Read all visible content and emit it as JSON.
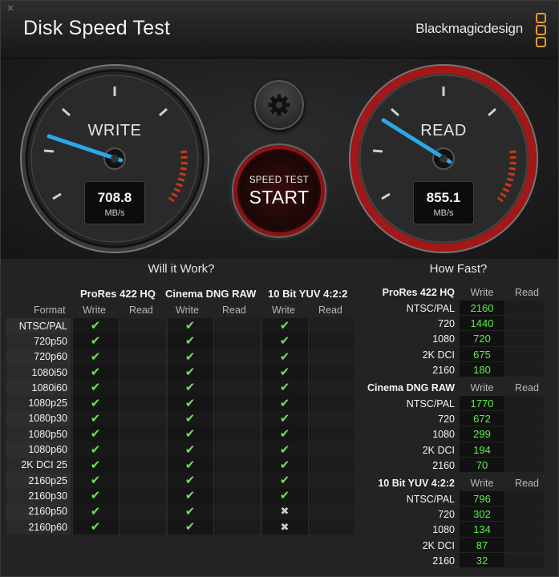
{
  "window": {
    "title": "Disk Speed Test",
    "brand": "Blackmagicdesign",
    "close_glyph": "✕"
  },
  "gauges": {
    "write": {
      "label": "WRITE",
      "value": "708.8",
      "unit": "MB/s"
    },
    "read": {
      "label": "READ",
      "value": "855.1",
      "unit": "MB/s"
    }
  },
  "controls": {
    "settings_icon": "gear-icon",
    "start_small": "SPEED TEST",
    "start_big": "START"
  },
  "will_it_work": {
    "heading": "Will it Work?",
    "format_label": "Format",
    "groups": [
      {
        "name": "ProRes 422 HQ",
        "write": "Write",
        "read": "Read"
      },
      {
        "name": "Cinema DNG RAW",
        "write": "Write",
        "read": "Read"
      },
      {
        "name": "10 Bit YUV 4:2:2",
        "write": "Write",
        "read": "Read"
      }
    ],
    "rows": [
      {
        "format": "NTSC/PAL",
        "w": [
          true,
          true,
          true
        ]
      },
      {
        "format": "720p50",
        "w": [
          true,
          true,
          true
        ]
      },
      {
        "format": "720p60",
        "w": [
          true,
          true,
          true
        ]
      },
      {
        "format": "1080i50",
        "w": [
          true,
          true,
          true
        ]
      },
      {
        "format": "1080i60",
        "w": [
          true,
          true,
          true
        ]
      },
      {
        "format": "1080p25",
        "w": [
          true,
          true,
          true
        ]
      },
      {
        "format": "1080p30",
        "w": [
          true,
          true,
          true
        ]
      },
      {
        "format": "1080p50",
        "w": [
          true,
          true,
          true
        ]
      },
      {
        "format": "1080p60",
        "w": [
          true,
          true,
          true
        ]
      },
      {
        "format": "2K DCI 25",
        "w": [
          true,
          true,
          true
        ]
      },
      {
        "format": "2160p25",
        "w": [
          true,
          true,
          true
        ]
      },
      {
        "format": "2160p30",
        "w": [
          true,
          true,
          true
        ]
      },
      {
        "format": "2160p50",
        "w": [
          true,
          true,
          false
        ]
      },
      {
        "format": "2160p60",
        "w": [
          true,
          true,
          false
        ]
      }
    ]
  },
  "how_fast": {
    "heading": "How Fast?",
    "groups": [
      {
        "name": "ProRes 422 HQ",
        "write": "Write",
        "read": "Read",
        "rows": [
          {
            "res": "NTSC/PAL",
            "w": "2160"
          },
          {
            "res": "720",
            "w": "1440"
          },
          {
            "res": "1080",
            "w": "720"
          },
          {
            "res": "2K DCI",
            "w": "675"
          },
          {
            "res": "2160",
            "w": "180"
          }
        ]
      },
      {
        "name": "Cinema DNG RAW",
        "write": "Write",
        "read": "Read",
        "rows": [
          {
            "res": "NTSC/PAL",
            "w": "1770"
          },
          {
            "res": "720",
            "w": "672"
          },
          {
            "res": "1080",
            "w": "299"
          },
          {
            "res": "2K DCI",
            "w": "194"
          },
          {
            "res": "2160",
            "w": "70"
          }
        ]
      },
      {
        "name": "10 Bit YUV 4:2:2",
        "write": "Write",
        "read": "Read",
        "rows": [
          {
            "res": "NTSC/PAL",
            "w": "796"
          },
          {
            "res": "720",
            "w": "302"
          },
          {
            "res": "1080",
            "w": "134"
          },
          {
            "res": "2K DCI",
            "w": "87"
          },
          {
            "res": "2160",
            "w": "32"
          }
        ]
      }
    ]
  },
  "colors": {
    "accent_orange": "#e89a2c",
    "check_green": "#6ee05a",
    "value_green": "#5cf04a",
    "needle_blue": "#29a8e8",
    "read_ring_red": "#a01818"
  }
}
